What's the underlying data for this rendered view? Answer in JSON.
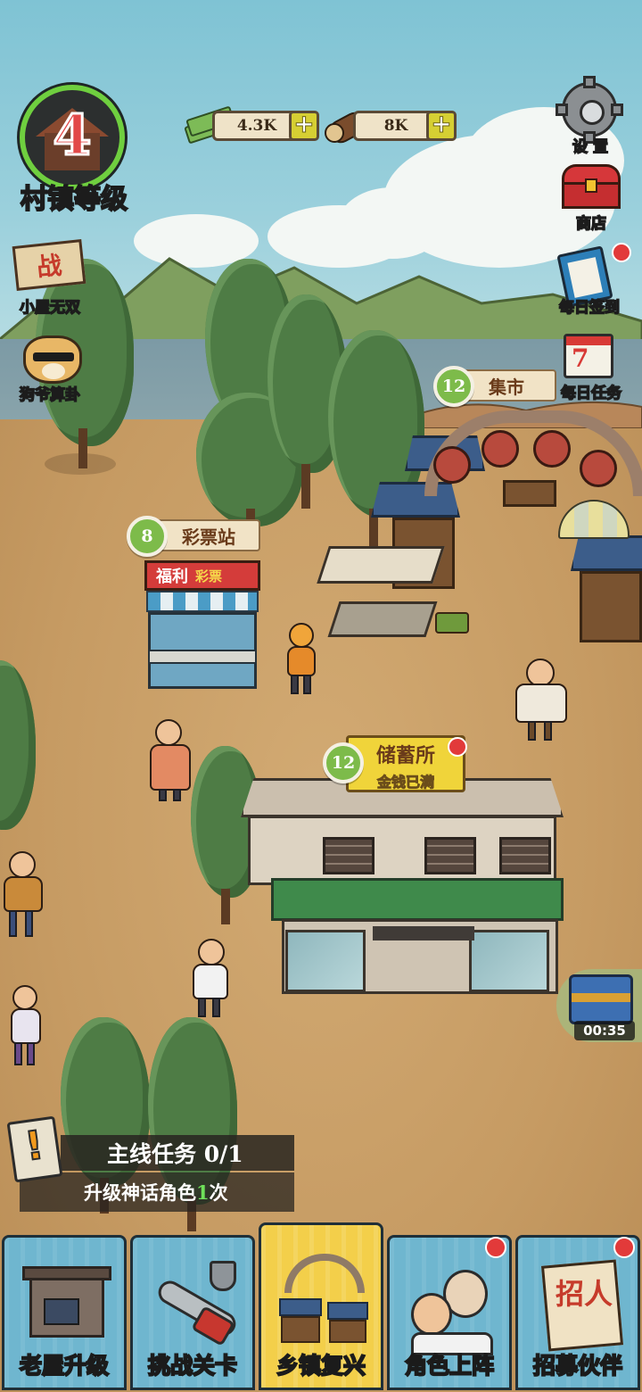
{
  "hud": {
    "town_level": "4",
    "town_level_label": "村镇等级",
    "money": "4.3K",
    "wood": "8K"
  },
  "side_left": {
    "battle_sign": "战",
    "battle_label": "小屋无双",
    "fortune_label": "狗爷算卦"
  },
  "side_right": {
    "settings_label": "设 置",
    "shop_label": "商店",
    "checkin_label": "每日签到",
    "tasks_label": "每日任务",
    "calendar_day": "7"
  },
  "buildings": {
    "market": {
      "level": "12",
      "name": "集市"
    },
    "lottery": {
      "level": "8",
      "name": "彩票站",
      "sign_main": "福利",
      "sign_sub": "彩票"
    },
    "savings": {
      "level": "12",
      "name": "储蓄所",
      "status": "金钱已满"
    }
  },
  "quest": {
    "title": "主线任务 0/1",
    "desc_prefix": "升级神话角色",
    "desc_count": "1",
    "desc_suffix": "次",
    "icon": "exclamation-icon"
  },
  "treasure": {
    "timer": "00:35"
  },
  "nav": {
    "tabs": [
      {
        "label": "老屋升级",
        "icon": "house-icon"
      },
      {
        "label": "挑战关卡",
        "icon": "chainsaw-icon"
      },
      {
        "label": "乡镇复兴",
        "icon": "market-icon"
      },
      {
        "label": "角色上阵",
        "icon": "characters-icon"
      },
      {
        "label": "招募伙伴",
        "icon": "recruit-icon"
      }
    ],
    "recruit_sign": "招人",
    "active_index": 2
  },
  "colors": {
    "sky": "#8fcbd9",
    "ground": "#c69b63",
    "level_ring": "#6fcf3f",
    "level_badge": "#7dbb4a",
    "active_tab": "#f3cf4a",
    "tab": "#6fb6cf",
    "notify_dot": "#e23a3a"
  }
}
